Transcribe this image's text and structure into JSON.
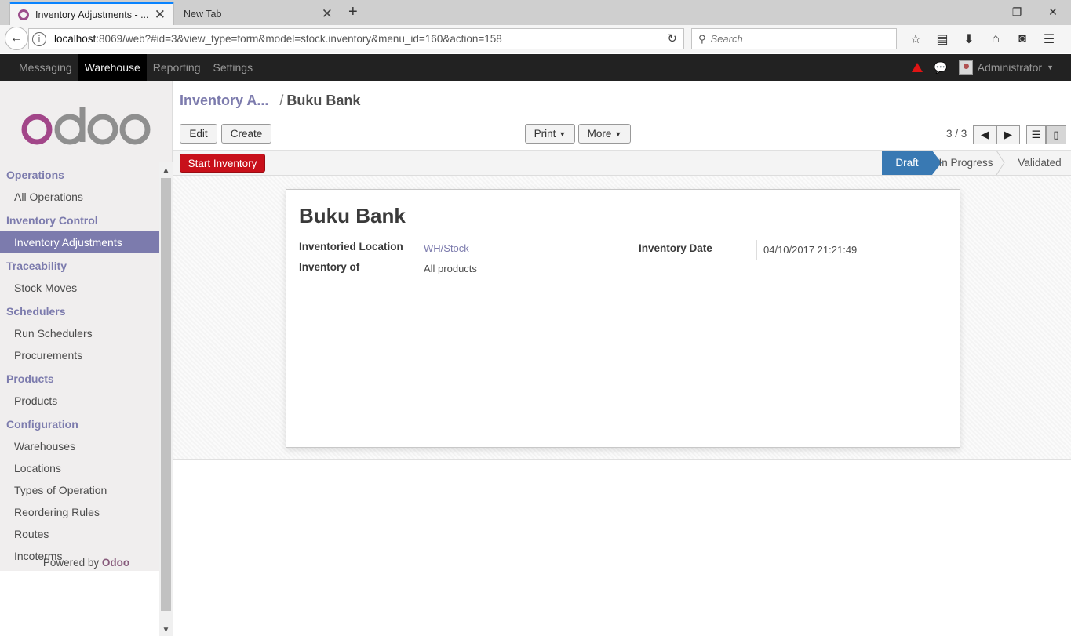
{
  "browser": {
    "active_tab_title": "Inventory Adjustments - ...",
    "inactive_tab_title": "New Tab",
    "url_host": "localhost",
    "url_rest": ":8069/web?#id=3&view_type=form&model=stock.inventory&menu_id=160&action=158",
    "search_placeholder": "Search"
  },
  "topmenu": {
    "items": [
      "Messaging",
      "Warehouse",
      "Reporting",
      "Settings"
    ],
    "active": "Warehouse",
    "user": "Administrator"
  },
  "sidebar": {
    "sections": [
      {
        "title": "Operations",
        "items": [
          "All Operations"
        ]
      },
      {
        "title": "Inventory Control",
        "items": [
          "Inventory Adjustments"
        ]
      },
      {
        "title": "Traceability",
        "items": [
          "Stock Moves"
        ]
      },
      {
        "title": "Schedulers",
        "items": [
          "Run Schedulers",
          "Procurements"
        ]
      },
      {
        "title": "Products",
        "items": [
          "Products"
        ]
      },
      {
        "title": "Configuration",
        "items": [
          "Warehouses",
          "Locations",
          "Types of Operation",
          "Reordering Rules",
          "Routes",
          "Incoterms"
        ]
      }
    ],
    "active_item": "Inventory Adjustments",
    "powered_by": "Powered by",
    "powered_brand": "Odoo"
  },
  "breadcrumb": {
    "parent": "Inventory A...",
    "separator": "/",
    "current": "Buku Bank"
  },
  "buttons": {
    "edit": "Edit",
    "create": "Create",
    "print": "Print",
    "more": "More",
    "start_inventory": "Start Inventory"
  },
  "pager": {
    "text": "3 / 3"
  },
  "stages": {
    "draft": "Draft",
    "in_progress": "In Progress",
    "validated": "Validated",
    "current": "Draft"
  },
  "record": {
    "name": "Buku Bank",
    "inventoried_location_label": "Inventoried Location",
    "inventoried_location_value": "WH/Stock",
    "inventory_of_label": "Inventory of",
    "inventory_of_value": "All products",
    "inventory_date_label": "Inventory Date",
    "inventory_date_value": "04/10/2017 21:21:49"
  },
  "colors": {
    "odoo_purple": "#7c7bad",
    "start_button_red": "#c8101a",
    "active_stage_blue": "#3979b3",
    "top_bar": "#222222"
  }
}
